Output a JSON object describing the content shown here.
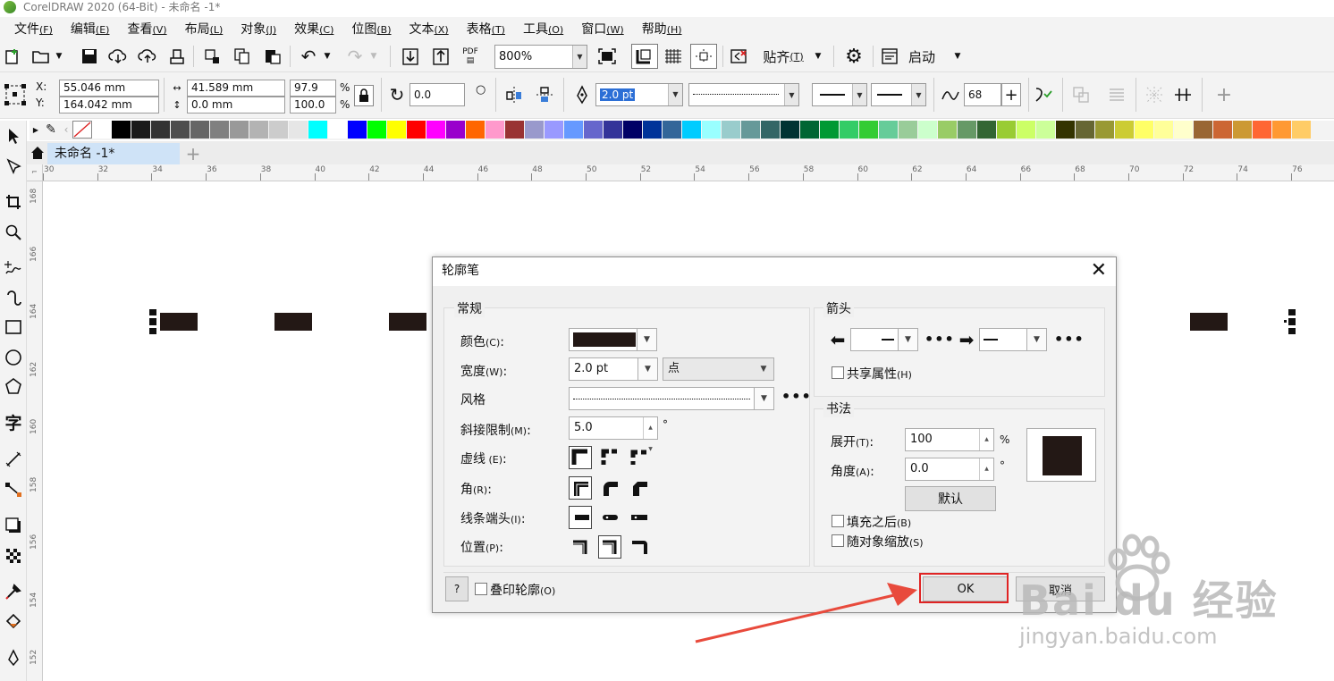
{
  "window": {
    "title": "CorelDRAW 2020 (64-Bit) - 未命名 -1*"
  },
  "menu": [
    {
      "label": "文件",
      "key": "(F)"
    },
    {
      "label": "编辑",
      "key": "(E)"
    },
    {
      "label": "查看",
      "key": "(V)"
    },
    {
      "label": "布局",
      "key": "(L)"
    },
    {
      "label": "对象",
      "key": "(J)"
    },
    {
      "label": "效果",
      "key": "(C)"
    },
    {
      "label": "位图",
      "key": "(B)"
    },
    {
      "label": "文本",
      "key": "(X)"
    },
    {
      "label": "表格",
      "key": "(T)"
    },
    {
      "label": "工具",
      "key": "(O)"
    },
    {
      "label": "窗口",
      "key": "(W)"
    },
    {
      "label": "帮助",
      "key": "(H)"
    }
  ],
  "standard_toolbar": {
    "zoom": "800%",
    "snap_label": "贴齐",
    "snap_key": "(T)",
    "launch_label": "启动",
    "pdf_label": "PDF"
  },
  "property_bar": {
    "x_label": "X:",
    "y_label": "Y:",
    "x_value": "55.046 mm",
    "y_value": "164.042 mm",
    "width_value": "41.589 mm",
    "height_value": "0.0 mm",
    "scale_x": "97.9",
    "scale_y": "100.0",
    "percent": "%",
    "rotation": "0.0",
    "outline_width": "2.0 pt",
    "smoothing": "68"
  },
  "palette_colors": [
    "#ffffff",
    "#000000",
    "#1a1a1a",
    "#333333",
    "#4d4d4d",
    "#666666",
    "#808080",
    "#999999",
    "#b3b3b3",
    "#cccccc",
    "#e6e6e6",
    "#00ffff",
    "#ffffff",
    "#0000ff",
    "#00ff00",
    "#ffff00",
    "#ff0000",
    "#ff00ff",
    "#9900cc",
    "#ff6600",
    "#ff99cc",
    "#993333",
    "#9999cc",
    "#9999ff",
    "#6699ff",
    "#6666cc",
    "#333399",
    "#000066",
    "#003399",
    "#336699",
    "#00ccff",
    "#99ffff",
    "#99cccc",
    "#669999",
    "#336666",
    "#003333",
    "#006633",
    "#009933",
    "#33cc66",
    "#33cc33",
    "#66cc99",
    "#99cc99",
    "#ccffcc",
    "#99cc66",
    "#669966",
    "#336633",
    "#99cc33",
    "#ccff66",
    "#ccff99",
    "#333300",
    "#666633",
    "#999933",
    "#cccc33",
    "#ffff66",
    "#ffff99",
    "#ffffcc",
    "#996633",
    "#cc6633",
    "#cc9933",
    "#ff6633",
    "#ff9933",
    "#ffcc66"
  ],
  "document": {
    "tab_label": "未命名 -1*"
  },
  "ruler": {
    "h": [
      "30",
      "32",
      "34",
      "36",
      "38",
      "40",
      "42",
      "44",
      "46",
      "48",
      "50",
      "52",
      "54",
      "56",
      "58",
      "60",
      "62",
      "64",
      "66",
      "68",
      "70",
      "72",
      "74",
      "76"
    ],
    "v": [
      "168",
      "166",
      "164",
      "162",
      "160",
      "158",
      "156",
      "154",
      "152"
    ]
  },
  "dialog": {
    "title": "轮廓笔",
    "general": {
      "title": "常规",
      "color_label": "颜色",
      "color_key": "(C)",
      "color_value": "#231815",
      "width_label": "宽度",
      "width_key": "(W)",
      "width_value": "2.0 pt",
      "unit_value": "点",
      "style_label": "风格",
      "miter_label": "斜接限制",
      "miter_key": "(M)",
      "miter_value": "5.0",
      "degree": "°",
      "dash_label": "虚线",
      "dash_key": "(E)",
      "corner_label": "角",
      "corner_key": "(R)",
      "cap_label": "线条端头",
      "cap_key": "(I)",
      "position_label": "位置",
      "position_key": "(P)"
    },
    "arrows": {
      "title": "箭头",
      "share_label": "共享属性",
      "share_key": "(H)"
    },
    "calligraphy": {
      "title": "书法",
      "stretch_label": "展开",
      "stretch_key": "(T)",
      "stretch_value": "100",
      "percent": "%",
      "angle_label": "角度",
      "angle_key": "(A)",
      "angle_value": "0.0",
      "degree": "°",
      "default_button": "默认",
      "fill_behind_label": "填充之后",
      "fill_behind_key": "(B)",
      "scale_label": "随对象缩放",
      "scale_key": "(S)"
    },
    "help_button": "?",
    "overprint_label": "叠印轮廓",
    "overprint_key": "(O)",
    "ok_button": "OK",
    "cancel_button": "取消"
  },
  "watermark": {
    "brand": "Bai  du 经验",
    "url": "jingyan.baidu.com"
  },
  "accent": {
    "highlight": "#e02424",
    "tab": "#cfe3f7"
  }
}
